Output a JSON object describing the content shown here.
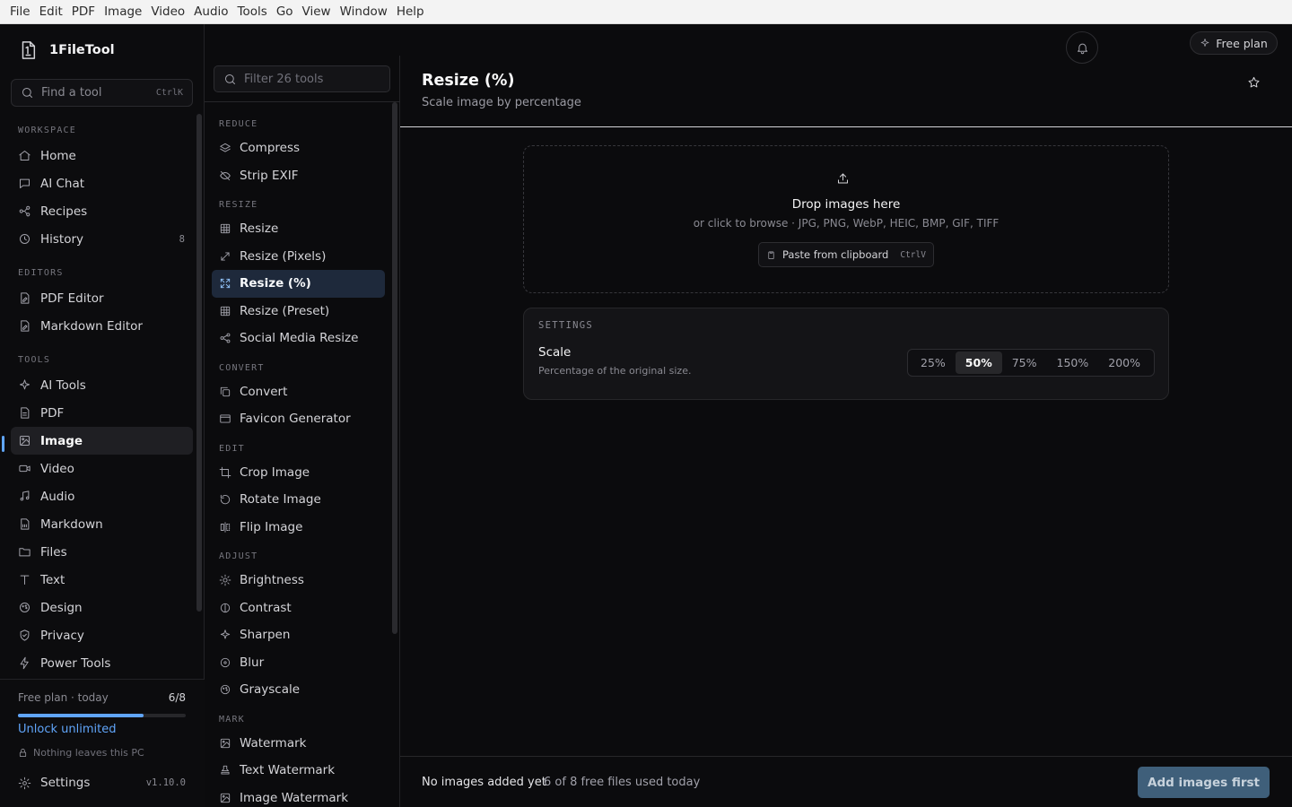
{
  "menubar": [
    "File",
    "Edit",
    "PDF",
    "Image",
    "Video",
    "Audio",
    "Tools",
    "Go",
    "View",
    "Window",
    "Help"
  ],
  "brand": {
    "name": "1FileTool",
    "icon": "file-logo-icon"
  },
  "search": {
    "placeholder": "Find a tool",
    "shortcut": "CtrlK"
  },
  "sidebar": {
    "sections": [
      {
        "label": "WORKSPACE",
        "items": [
          {
            "label": "Home",
            "icon": "home-icon"
          },
          {
            "label": "AI Chat",
            "icon": "chat-icon"
          },
          {
            "label": "Recipes",
            "icon": "recipes-icon"
          },
          {
            "label": "History",
            "icon": "history-icon",
            "count": "8"
          }
        ]
      },
      {
        "label": "EDITORS",
        "items": [
          {
            "label": "PDF Editor",
            "icon": "pdf-edit-icon"
          },
          {
            "label": "Markdown Editor",
            "icon": "markdown-edit-icon"
          }
        ]
      },
      {
        "label": "TOOLS",
        "items": [
          {
            "label": "AI Tools",
            "icon": "sparkle-icon"
          },
          {
            "label": "PDF",
            "icon": "pdf-icon"
          },
          {
            "label": "Image",
            "icon": "image-icon",
            "active": true
          },
          {
            "label": "Video",
            "icon": "video-icon"
          },
          {
            "label": "Audio",
            "icon": "music-icon"
          },
          {
            "label": "Markdown",
            "icon": "markdown-icon"
          },
          {
            "label": "Files",
            "icon": "folder-icon"
          },
          {
            "label": "Text",
            "icon": "text-icon"
          },
          {
            "label": "Design",
            "icon": "palette-icon"
          },
          {
            "label": "Privacy",
            "icon": "shield-icon"
          },
          {
            "label": "Power Tools",
            "icon": "bolt-icon"
          }
        ]
      }
    ]
  },
  "plan": {
    "label": "Free plan · today",
    "count": "6/8",
    "progress": 0.75,
    "unlock": "Unlock unlimited",
    "privacy": "Nothing leaves this PC"
  },
  "settings_nav": {
    "label": "Settings",
    "version": "v1.10.0"
  },
  "tool_filter": {
    "placeholder": "Filter 26 tools"
  },
  "tool_groups": [
    {
      "label": "REDUCE",
      "items": [
        {
          "label": "Compress",
          "icon": "layers-icon"
        },
        {
          "label": "Strip EXIF",
          "icon": "eye-off-icon"
        }
      ]
    },
    {
      "label": "RESIZE",
      "items": [
        {
          "label": "Resize",
          "icon": "grid-icon"
        },
        {
          "label": "Resize (Pixels)",
          "icon": "diagonal-arrows-icon"
        },
        {
          "label": "Resize (%)",
          "icon": "expand-icon",
          "active": true
        },
        {
          "label": "Resize (Preset)",
          "icon": "grid-icon"
        },
        {
          "label": "Social Media Resize",
          "icon": "share-icon"
        }
      ]
    },
    {
      "label": "CONVERT",
      "items": [
        {
          "label": "Convert",
          "icon": "copy-icon"
        },
        {
          "label": "Favicon Generator",
          "icon": "window-icon"
        }
      ]
    },
    {
      "label": "EDIT",
      "items": [
        {
          "label": "Crop Image",
          "icon": "crop-icon"
        },
        {
          "label": "Rotate Image",
          "icon": "rotate-icon"
        },
        {
          "label": "Flip Image",
          "icon": "flip-icon"
        }
      ]
    },
    {
      "label": "ADJUST",
      "items": [
        {
          "label": "Brightness",
          "icon": "sun-icon"
        },
        {
          "label": "Contrast",
          "icon": "contrast-icon"
        },
        {
          "label": "Sharpen",
          "icon": "sparkle-icon"
        },
        {
          "label": "Blur",
          "icon": "blur-icon"
        },
        {
          "label": "Grayscale",
          "icon": "palette-icon"
        }
      ]
    },
    {
      "label": "MARK",
      "items": [
        {
          "label": "Watermark",
          "icon": "image-mark-icon"
        },
        {
          "label": "Text Watermark",
          "icon": "stamp-icon"
        },
        {
          "label": "Image Watermark",
          "icon": "image-mark-icon"
        }
      ]
    }
  ],
  "header": {
    "title": "Resize (%)",
    "subtitle": "Scale image by percentage",
    "free_plan": "Free plan"
  },
  "dropzone": {
    "title": "Drop images here",
    "hint": "or click to browse · JPG, PNG, WebP, HEIC, BMP, GIF, TIFF",
    "paste_label": "Paste from clipboard",
    "paste_shortcut": "CtrlV"
  },
  "settings_panel": {
    "label": "SETTINGS",
    "scale_label": "Scale",
    "scale_desc": "Percentage of the original size.",
    "options": [
      "25%",
      "50%",
      "75%",
      "150%",
      "200%"
    ],
    "selected": "50%"
  },
  "footer": {
    "status": "No images added yet",
    "usage": "6 of 8 free files used today",
    "action": "Add images first"
  },
  "colors": {
    "accent": "#60a5fa",
    "active_tool_bg": "#1e293b",
    "primary_button": "#3f5f7a"
  }
}
